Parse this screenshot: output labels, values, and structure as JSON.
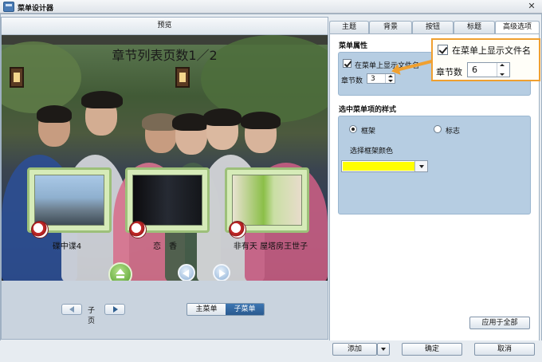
{
  "window": {
    "title": "菜单设计器",
    "close_glyph": "✕"
  },
  "preview": {
    "header": "预览",
    "chapter_title": "章节列表页数1／2",
    "thumbnails": [
      {
        "label": "碟中谍4"
      },
      {
        "label": "恋　香"
      },
      {
        "label": "非有天 屋塔房王世子"
      }
    ],
    "pager_label": "子页",
    "segments": [
      "主菜单",
      "子菜单"
    ],
    "active_segment": "子菜单"
  },
  "tabs": [
    "主题",
    "背景",
    "按钮",
    "标题",
    "高级选项"
  ],
  "active_tab": "高级选项",
  "menu_props": {
    "section_title": "菜单属性",
    "show_filename_label": "在菜单上显示文件名",
    "show_filename_checked": true,
    "chapters_label": "章节数",
    "chapters_value": "3"
  },
  "selected_style": {
    "section_title": "选中菜单项的样式",
    "option_frame": "框架",
    "option_logo": "标志",
    "selected": "框架",
    "color_label": "选择框架颜色",
    "color_value": "#FFFF00"
  },
  "apply_all": "应用于全部",
  "callout": {
    "show_filename_label": "在菜单上显示文件名",
    "chapters_label": "章节数",
    "chapters_value": "6",
    "accent_color": "#F0A030"
  },
  "footer": {
    "add": "添加",
    "ok": "确定",
    "cancel": "取消"
  }
}
